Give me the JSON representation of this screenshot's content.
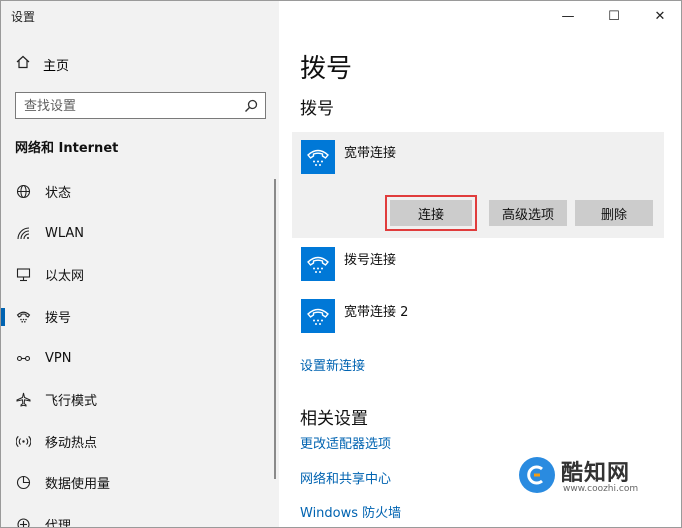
{
  "window": {
    "title": "设置"
  },
  "caption": {
    "minimize": "—",
    "maximize": "☐",
    "close": "✕"
  },
  "sidebar": {
    "home_label": "主页",
    "search_placeholder": "查找设置",
    "section_title": "网络和 Internet",
    "items": [
      {
        "label": "状态",
        "icon": "globe-icon"
      },
      {
        "label": "WLAN",
        "icon": "wifi-icon"
      },
      {
        "label": "以太网",
        "icon": "ethernet-icon"
      },
      {
        "label": "拨号",
        "icon": "dialup-icon",
        "selected": true
      },
      {
        "label": "VPN",
        "icon": "vpn-icon"
      },
      {
        "label": "飞行模式",
        "icon": "airplane-icon"
      },
      {
        "label": "移动热点",
        "icon": "hotspot-icon"
      },
      {
        "label": "数据使用量",
        "icon": "data-usage-icon"
      },
      {
        "label": "代理",
        "icon": "proxy-icon"
      }
    ]
  },
  "main": {
    "page_title": "拨号",
    "section_title": "拨号",
    "connections": [
      {
        "name": "宽带连接",
        "expanded": true
      },
      {
        "name": "拨号连接"
      },
      {
        "name": "宽带连接 2"
      }
    ],
    "buttons": {
      "connect": "连接",
      "advanced": "高级选项",
      "delete": "删除"
    },
    "setup_link": "设置新连接",
    "related_title": "相关设置",
    "related_links": [
      "更改适配器选项",
      "网络和共享中心",
      "Windows 防火墙"
    ]
  },
  "watermark": {
    "brand": "酷知网",
    "url": "www.coozhi.com"
  },
  "colors": {
    "accent": "#0078d7",
    "link": "#0063b1",
    "highlight": "#e03c3c"
  }
}
